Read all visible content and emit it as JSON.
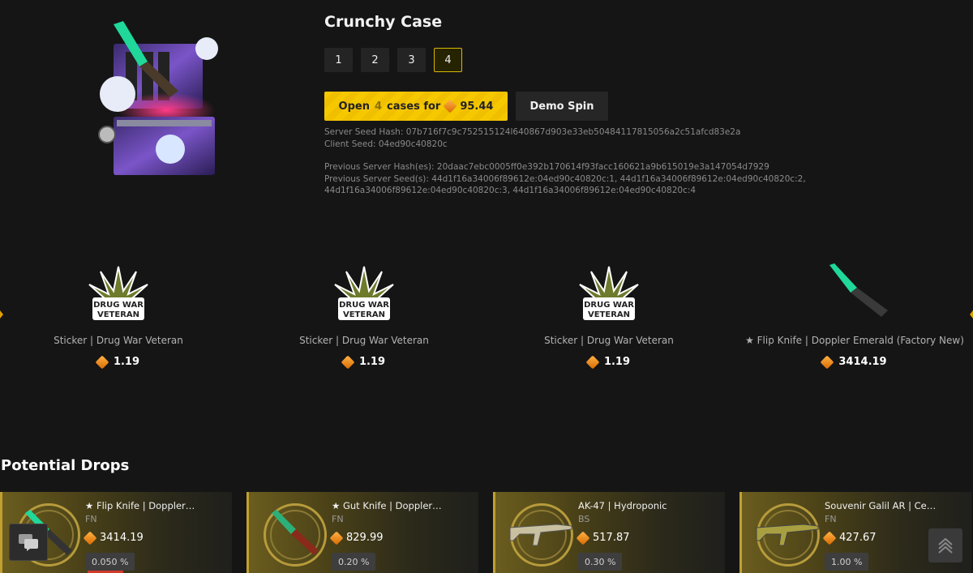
{
  "case": {
    "title": "Crunchy Case",
    "quantities": [
      "1",
      "2",
      "3",
      "4"
    ],
    "selected_quantity": "4",
    "open_button": {
      "prefix": "Open",
      "count": "4",
      "middle": "cases for",
      "price": "95.44"
    },
    "demo_button": "Demo Spin",
    "server_seed_hash": "Server Seed Hash: 07b716f7c9c752515124l640867d903e33eb50484117815056a2c51afcd83e2a",
    "client_seed": "Client Seed: 04ed90c40820c",
    "previous_hashes": "Previous Server Hash(es): 20daac7ebc0005ff0e392b170614f93facc160621a9b615019e3a147054d7929",
    "previous_seeds": "Previous Server Seed(s): 44d1f16a34006f89612e:04ed90c40820c:1, 44d1f16a34006f89612e:04ed90c40820c:2, 44d1f16a34006f89612e:04ed90c40820c:3, 44d1f16a34006f89612e:04ed90c40820c:4"
  },
  "reel": [
    {
      "name": "Sticker | Drug War Veteran",
      "price": "1.19",
      "icon": "sticker-icon"
    },
    {
      "name": "Sticker | Drug War Veteran",
      "price": "1.19",
      "icon": "sticker-icon"
    },
    {
      "name": "Sticker | Drug War Veteran",
      "price": "1.19",
      "icon": "sticker-icon"
    },
    {
      "name": "★ Flip Knife | Doppler Emerald (Factory New)",
      "price": "3414.19",
      "icon": "knife-icon"
    }
  ],
  "sticker_text": [
    "DRUG WAR",
    "VETERAN"
  ],
  "drops": {
    "title": "Potential Drops",
    "items": [
      {
        "name": "★ Flip Knife | Doppler…",
        "condition": "FN",
        "price": "3414.19",
        "odds": "0.050 %",
        "icon": "knife-icon"
      },
      {
        "name": "★ Gut Knife | Doppler…",
        "condition": "FN",
        "price": "829.99",
        "odds": "0.20 %",
        "icon": "knife-icon"
      },
      {
        "name": "AK-47 | Hydroponic",
        "condition": "BS",
        "price": "517.87",
        "odds": "0.30 %",
        "icon": "rifle-icon"
      },
      {
        "name": "Souvenir Galil AR | Ce…",
        "condition": "FN",
        "price": "427.67",
        "odds": "1.00 %",
        "icon": "rifle-icon"
      }
    ]
  },
  "colors": {
    "accent": "#f5c800",
    "coin": "#e08a10",
    "background": "#151515"
  }
}
